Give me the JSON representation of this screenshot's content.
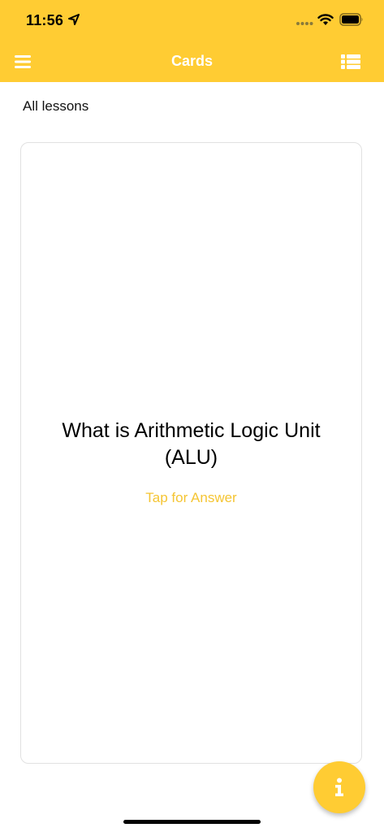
{
  "status_bar": {
    "time": "11:56"
  },
  "nav": {
    "title": "Cards"
  },
  "lessons_label": "All lessons",
  "card": {
    "question": "What is Arithmetic Logic Unit (ALU)",
    "tap_prompt": "Tap for Answer"
  },
  "colors": {
    "accent": "#FFCC33",
    "tap_text": "#F5C533"
  },
  "icons": {
    "menu": "hamburger-menu-icon",
    "list": "list-icon",
    "info": "info-icon",
    "location": "location-arrow-icon",
    "wifi": "wifi-icon",
    "battery": "battery-icon",
    "signal": "cellular-signal-icon"
  }
}
